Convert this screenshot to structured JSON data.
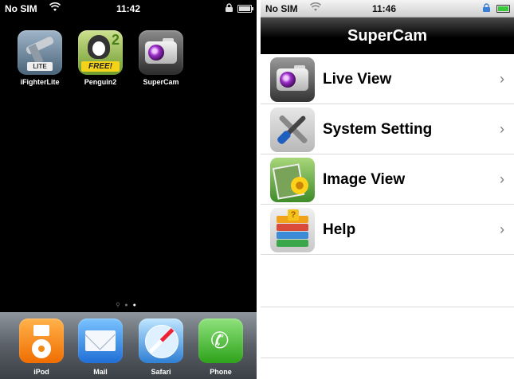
{
  "home_screen": {
    "status_bar": {
      "carrier": "No SIM",
      "time": "11:42"
    },
    "apps": [
      {
        "label": "iFighterLite",
        "badge_text": "LITE",
        "icon": "fighter-jet-icon"
      },
      {
        "label": "Penguin2",
        "badge_text": "FREE!",
        "number": "2",
        "icon": "penguin-icon"
      },
      {
        "label": "SuperCam",
        "icon": "camera-icon"
      }
    ],
    "page_count": 2,
    "current_page": 2,
    "dock": [
      {
        "label": "iPod",
        "icon": "ipod-icon"
      },
      {
        "label": "Mail",
        "icon": "mail-icon"
      },
      {
        "label": "Safari",
        "icon": "safari-icon"
      },
      {
        "label": "Phone",
        "icon": "phone-icon"
      }
    ]
  },
  "supercam": {
    "status_bar": {
      "carrier": "No SIM",
      "time": "11:46",
      "battery_color": "#3ac93a"
    },
    "title": "SuperCam",
    "menu": [
      {
        "label": "Live View",
        "icon": "camera-icon"
      },
      {
        "label": "System Setting",
        "icon": "tools-icon"
      },
      {
        "label": "Image View",
        "icon": "photo-icon"
      },
      {
        "label": "Help",
        "icon": "books-icon"
      }
    ],
    "chevron": "›"
  }
}
